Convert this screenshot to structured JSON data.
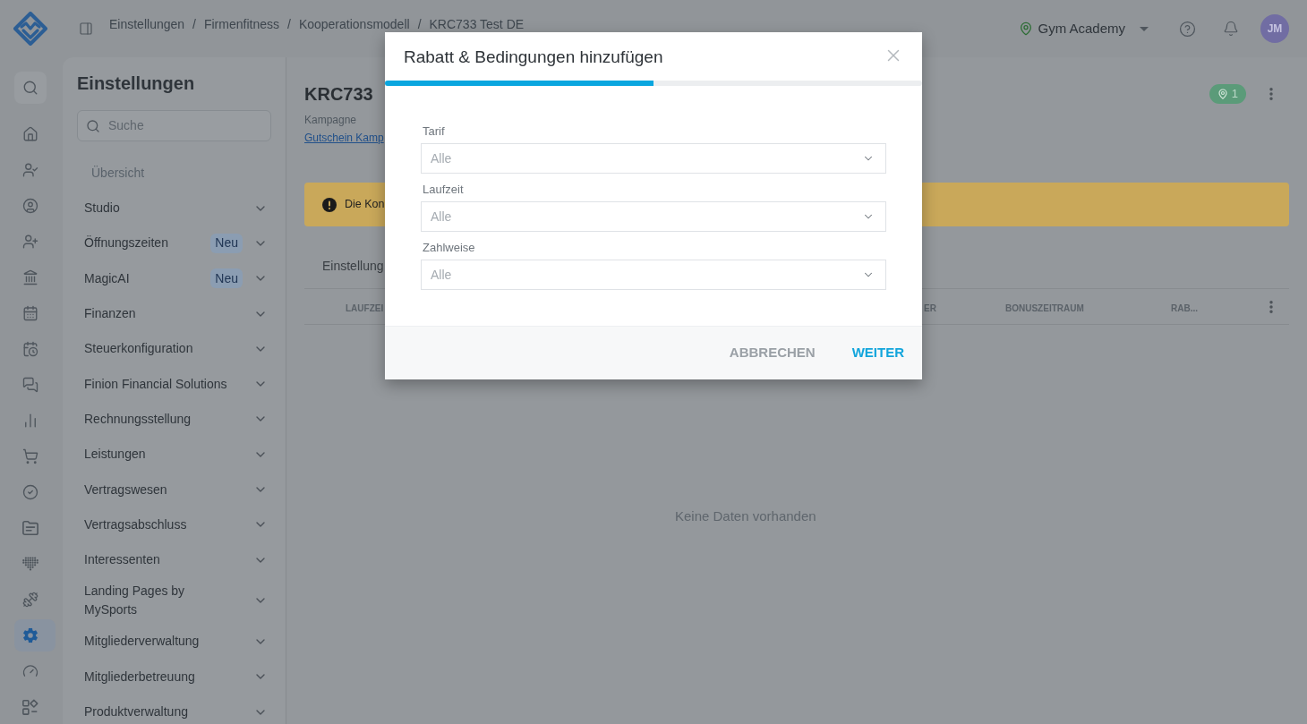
{
  "header": {
    "breadcrumb": {
      "separator": "/",
      "items": [
        "Einstellungen",
        "Firmenfitness",
        "Kooperationsmodell",
        "KRC733 Test DE"
      ]
    },
    "location": "Gym Academy",
    "avatar_initials": "JM"
  },
  "rail": {
    "items": [
      {
        "kind": "search",
        "selected": false
      },
      {
        "kind": "home",
        "selected": false
      },
      {
        "kind": "user-check",
        "selected": false
      },
      {
        "kind": "profile",
        "selected": false
      },
      {
        "kind": "user-add",
        "selected": false
      },
      {
        "kind": "bank",
        "selected": false
      },
      {
        "kind": "calendar",
        "selected": false
      },
      {
        "kind": "schedule",
        "selected": false
      },
      {
        "kind": "messages",
        "selected": false
      },
      {
        "kind": "stats",
        "selected": false
      },
      {
        "kind": "shop",
        "selected": false
      },
      {
        "kind": "tasks",
        "selected": false
      },
      {
        "kind": "documents",
        "selected": false
      },
      {
        "kind": "devices",
        "selected": false
      },
      {
        "kind": "training",
        "selected": false
      },
      {
        "kind": "settings",
        "selected": true
      },
      {
        "kind": "gauge",
        "selected": false
      },
      {
        "kind": "shapes",
        "selected": false
      }
    ]
  },
  "sidebar": {
    "title": "Einstellungen",
    "search": {
      "placeholder": "Suche"
    },
    "overview": "Übersicht",
    "items": [
      {
        "label": "Studio",
        "expanded": false
      },
      {
        "label": "Öffnungszeiten",
        "badge": "Neu",
        "expanded": false
      },
      {
        "label": "MagicAI",
        "badge": "Neu",
        "expanded": false
      },
      {
        "label": "Finanzen",
        "expanded": false
      },
      {
        "label": "Steuerkonfiguration",
        "expanded": false
      },
      {
        "label": "Finion Financial Solutions",
        "expanded": false
      },
      {
        "label": "Rechnungsstellung",
        "expanded": false
      },
      {
        "label": "Leistungen",
        "expanded": false
      },
      {
        "label": "Vertragswesen",
        "expanded": false
      },
      {
        "label": "Vertragsabschluss",
        "expanded": false
      },
      {
        "label": "Interessenten",
        "expanded": false
      },
      {
        "label": "Landing Pages by MySports",
        "expanded": false
      },
      {
        "label": "Mitgliederverwaltung",
        "expanded": false
      },
      {
        "label": "Mitgliederbetreuung",
        "expanded": false
      },
      {
        "label": "Produktverwaltung",
        "expanded": false
      }
    ]
  },
  "main": {
    "title": "KRC733",
    "subtitle": "Kampagne",
    "link": "Gutschein Kamp",
    "location_count": "1",
    "alert": "Die Kon",
    "tab": "Einstellung",
    "table": {
      "columns": [
        "LAUFZEI",
        "ER",
        "BONUSZEITRAUM",
        "RAB..."
      ],
      "empty_text": "Keine Daten vorhanden"
    }
  },
  "modal": {
    "title": "Rabatt & Bedingungen hinzufügen",
    "progress": {
      "level": 0.5
    },
    "fields": [
      {
        "label": "Tarif",
        "placeholder": "Alle"
      },
      {
        "label": "Laufzeit",
        "placeholder": "Alle"
      },
      {
        "label": "Zahlweise",
        "placeholder": "Alle"
      }
    ],
    "buttons": [
      {
        "label": "ABBRECHEN",
        "kind": "secondary"
      },
      {
        "label": "WEITER",
        "kind": "primary"
      }
    ]
  }
}
